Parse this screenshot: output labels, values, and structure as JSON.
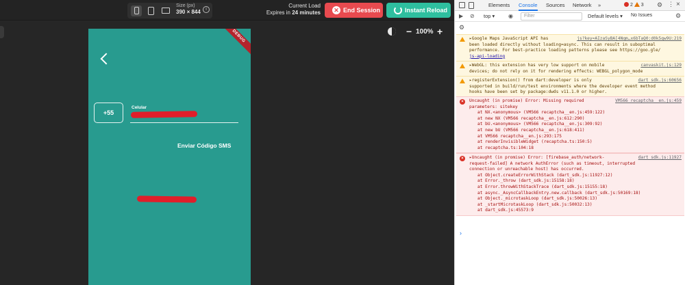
{
  "toolbar": {
    "size_label": "Size (px)",
    "size_value": "390 × 844",
    "info": "i",
    "load_label": "Current Load",
    "expires_prefix": "Expires in ",
    "expires_value": "24 minutes",
    "end_session": "End Session",
    "end_icon": "x-icon",
    "instant_reload": "Instant Reload",
    "zoom": "100%",
    "zoom_minus": "−",
    "zoom_plus": "+",
    "colors": {
      "end": "#e84a4f",
      "reload": "#2ebf9f"
    }
  },
  "app": {
    "debug_banner": "DEBUG",
    "country_code": "+55",
    "phone_label": "Celular",
    "send_sms": "Enviar Código SMS",
    "background": "#289b8f"
  },
  "devtools": {
    "tabs": [
      "Elements",
      "Console",
      "Sources",
      "Network",
      "»"
    ],
    "selected_tab": "Console",
    "error_count": "2",
    "warning_count": "3",
    "context": "top ▾",
    "filter_placeholder": "Filter",
    "levels": "Default levels ▾",
    "issues": "No Issues",
    "messages": [
      {
        "level": "warning",
        "source": "js?key=AIzaSyBA[4Nqm…x6bTaQ0:d0k5qw9U:219",
        "lines": [
          "▸Google Maps JavaScript API has",
          "been loaded directly without loading=async. This can result in suboptimal",
          "performance. For best-practice loading patterns please see https://goo.gle/",
          "js-api-loading"
        ]
      },
      {
        "level": "warning",
        "source": "canvaskit.js:129",
        "lines": [
          "▸WebGL: this extension has very low support on mobile",
          "devices; do not rely on it for rendering effects: WEBGL_polygon_mode"
        ]
      },
      {
        "level": "warning",
        "source": "dart_sdk.js:60656",
        "lines": [
          "▸registerExtension() from dart:developer is only",
          "supported in build/run/test environments where the developer event method",
          "hooks have been set by package:dwds v11.1.0 or higher."
        ]
      },
      {
        "level": "error",
        "source": "VM566 recaptcha__en.js:459",
        "lines": [
          "Uncaught (in promise) Error: Missing required",
          "parameters: sitekey"
        ],
        "stack": [
          "at NX.<anonymous> (VM566 recaptcha__en.js:459:122)",
          "at new NX (VM566 recaptcha__en.js:612:290)",
          "at bU.<anonymous> (VM566 recaptcha__en.js:309:92)",
          "at new bU (VM566 recaptcha__en.js:618:411)",
          "at VM566 recaptcha__en.js:293:175",
          "at renderInvisibleWidget (recaptcha.ts:150:5)",
          "at recaptcha.ts:104:18"
        ]
      },
      {
        "level": "error",
        "source": "dart_sdk.js:11927",
        "lines": [
          "▸Uncaught (in promise) Error: [firebase_auth/network-",
          "request-failed] A network AuthError (such as timeout, interrupted",
          "connection or unreachable host) has occurred.",
          ""
        ],
        "stack": [
          "at Object.createErrorWithStack (dart_sdk.js:11927:12)",
          "at Error._throw (dart_sdk.js:15158:18)",
          "at Error.throwWithStackTrace (dart_sdk.js:15155:18)",
          "at async._AsyncCallbackEntry.new.callback (dart_sdk.js:50169:18)",
          "at Object._microtaskLoop (dart_sdk.js:50026:13)",
          "at _startMicrotaskLoop (dart_sdk.js:50032:13)",
          "at dart_sdk.js:45573:9"
        ]
      }
    ],
    "prompt": "›"
  }
}
